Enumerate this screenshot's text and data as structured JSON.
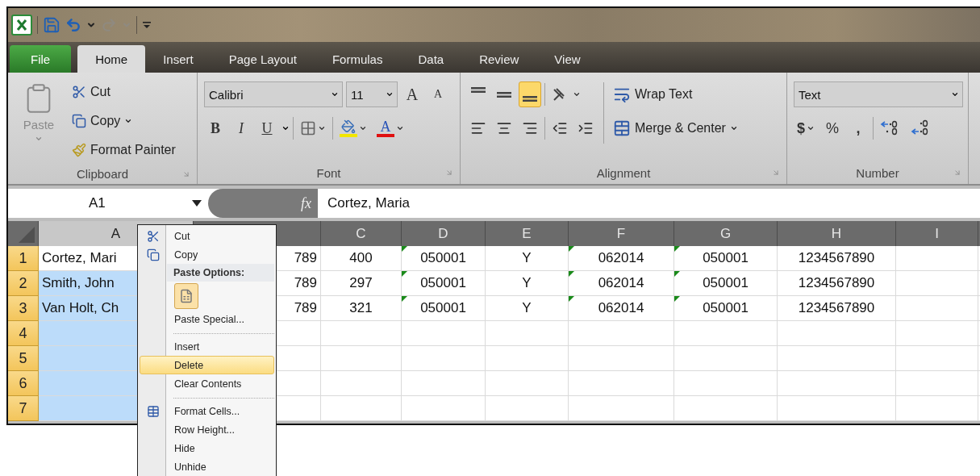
{
  "quick_access": {
    "redo_disabled": true
  },
  "tabs": [
    {
      "label": "File",
      "kind": "file",
      "selected": false
    },
    {
      "label": "Home",
      "kind": "tab",
      "selected": true
    },
    {
      "label": "Insert",
      "kind": "tab",
      "selected": false
    },
    {
      "label": "Page Layout",
      "kind": "tab",
      "selected": false
    },
    {
      "label": "Formulas",
      "kind": "tab",
      "selected": false
    },
    {
      "label": "Data",
      "kind": "tab",
      "selected": false
    },
    {
      "label": "Review",
      "kind": "tab",
      "selected": false
    },
    {
      "label": "View",
      "kind": "tab",
      "selected": false
    }
  ],
  "clipboard": {
    "title": "Clipboard",
    "paste": "Paste",
    "paste_disabled": true,
    "cut": "Cut",
    "copy": "Copy",
    "format_painter": "Format Painter"
  },
  "font": {
    "title": "Font",
    "font_name": "Calibri",
    "font_size": "11",
    "grow": "A",
    "shrink": "A",
    "bold": "B",
    "italic": "I",
    "underline": "U",
    "font_color": "A"
  },
  "alignment": {
    "title": "Alignment",
    "wrap_text": "Wrap Text",
    "merge_center": "Merge & Center",
    "vertical": [
      {
        "kind": "top",
        "selected": false
      },
      {
        "kind": "middle",
        "selected": false
      },
      {
        "kind": "bottom",
        "selected": true
      }
    ]
  },
  "number": {
    "title": "Number",
    "format": "Text",
    "currency": "$",
    "percent": "%",
    "comma": ","
  },
  "formula_bar": {
    "name_box": "A1",
    "function_label": "fx",
    "value": "Cortez, Maria"
  },
  "sheet": {
    "columns": [
      {
        "label": "A",
        "selected": true,
        "kind": "left",
        "flagged": false
      },
      {
        "selected": false,
        "kind": "right"
      },
      {
        "label": "C",
        "selected": false,
        "kind": "center",
        "flagged": false
      },
      {
        "label": "D",
        "selected": false,
        "kind": "center",
        "flagged": true
      },
      {
        "label": "E",
        "selected": false,
        "kind": "center",
        "flagged": false
      },
      {
        "label": "F",
        "selected": false,
        "kind": "center",
        "flagged": true
      },
      {
        "label": "G",
        "selected": false,
        "kind": "center",
        "flagged": true
      },
      {
        "label": "H",
        "selected": false,
        "kind": "center",
        "flagged": false
      },
      {
        "label": "I",
        "selected": false,
        "kind": "center"
      }
    ],
    "rows": [
      {
        "header": "1",
        "selected": true,
        "active": true,
        "cells": [
          "Cortez, Mari",
          "789",
          "400",
          "050001",
          "Y",
          "062014",
          "050001",
          "1234567890",
          ""
        ]
      },
      {
        "header": "2",
        "selected": true,
        "active": false,
        "cells": [
          "Smith, John",
          "789",
          "297",
          "050001",
          "Y",
          "062014",
          "050001",
          "1234567890",
          ""
        ]
      },
      {
        "header": "3",
        "selected": true,
        "active": false,
        "cells": [
          "Van Holt, Ch",
          "789",
          "321",
          "050001",
          "Y",
          "062014",
          "050001",
          "1234567890",
          ""
        ]
      },
      {
        "header": "4",
        "selected": true,
        "active": false,
        "cells": [
          "",
          "",
          "",
          "",
          "",
          "",
          "",
          "",
          ""
        ]
      },
      {
        "header": "5",
        "selected": true,
        "active": false,
        "cells": [
          "",
          "",
          "",
          "",
          "",
          "",
          "",
          "",
          ""
        ]
      },
      {
        "header": "6",
        "selected": true,
        "active": false,
        "cells": [
          "",
          "",
          "",
          "",
          "",
          "",
          "",
          "",
          ""
        ]
      },
      {
        "header": "7",
        "selected": true,
        "active": false,
        "cells": [
          "",
          "",
          "",
          "",
          "",
          "",
          "",
          "",
          ""
        ]
      }
    ]
  },
  "context_menu": [
    {
      "kind": "item",
      "label": "Cut",
      "selected": false
    },
    {
      "kind": "item",
      "label": "Copy",
      "selected": false
    },
    {
      "kind": "header",
      "label": "Paste Options:"
    },
    {
      "kind": "paste"
    },
    {
      "kind": "item",
      "label": "Paste Special...",
      "selected": false
    },
    {
      "kind": "separator"
    },
    {
      "kind": "item",
      "label": "Insert",
      "selected": false
    },
    {
      "kind": "item",
      "label": "Delete",
      "selected": true
    },
    {
      "kind": "item",
      "label": "Clear Contents",
      "selected": false
    },
    {
      "kind": "separator"
    },
    {
      "kind": "item",
      "label": "Format Cells...",
      "selected": false
    },
    {
      "kind": "item",
      "label": "Row Height...",
      "selected": false
    },
    {
      "kind": "item",
      "label": "Hide",
      "selected": false
    },
    {
      "kind": "item",
      "label": "Unhide",
      "selected": false
    }
  ]
}
